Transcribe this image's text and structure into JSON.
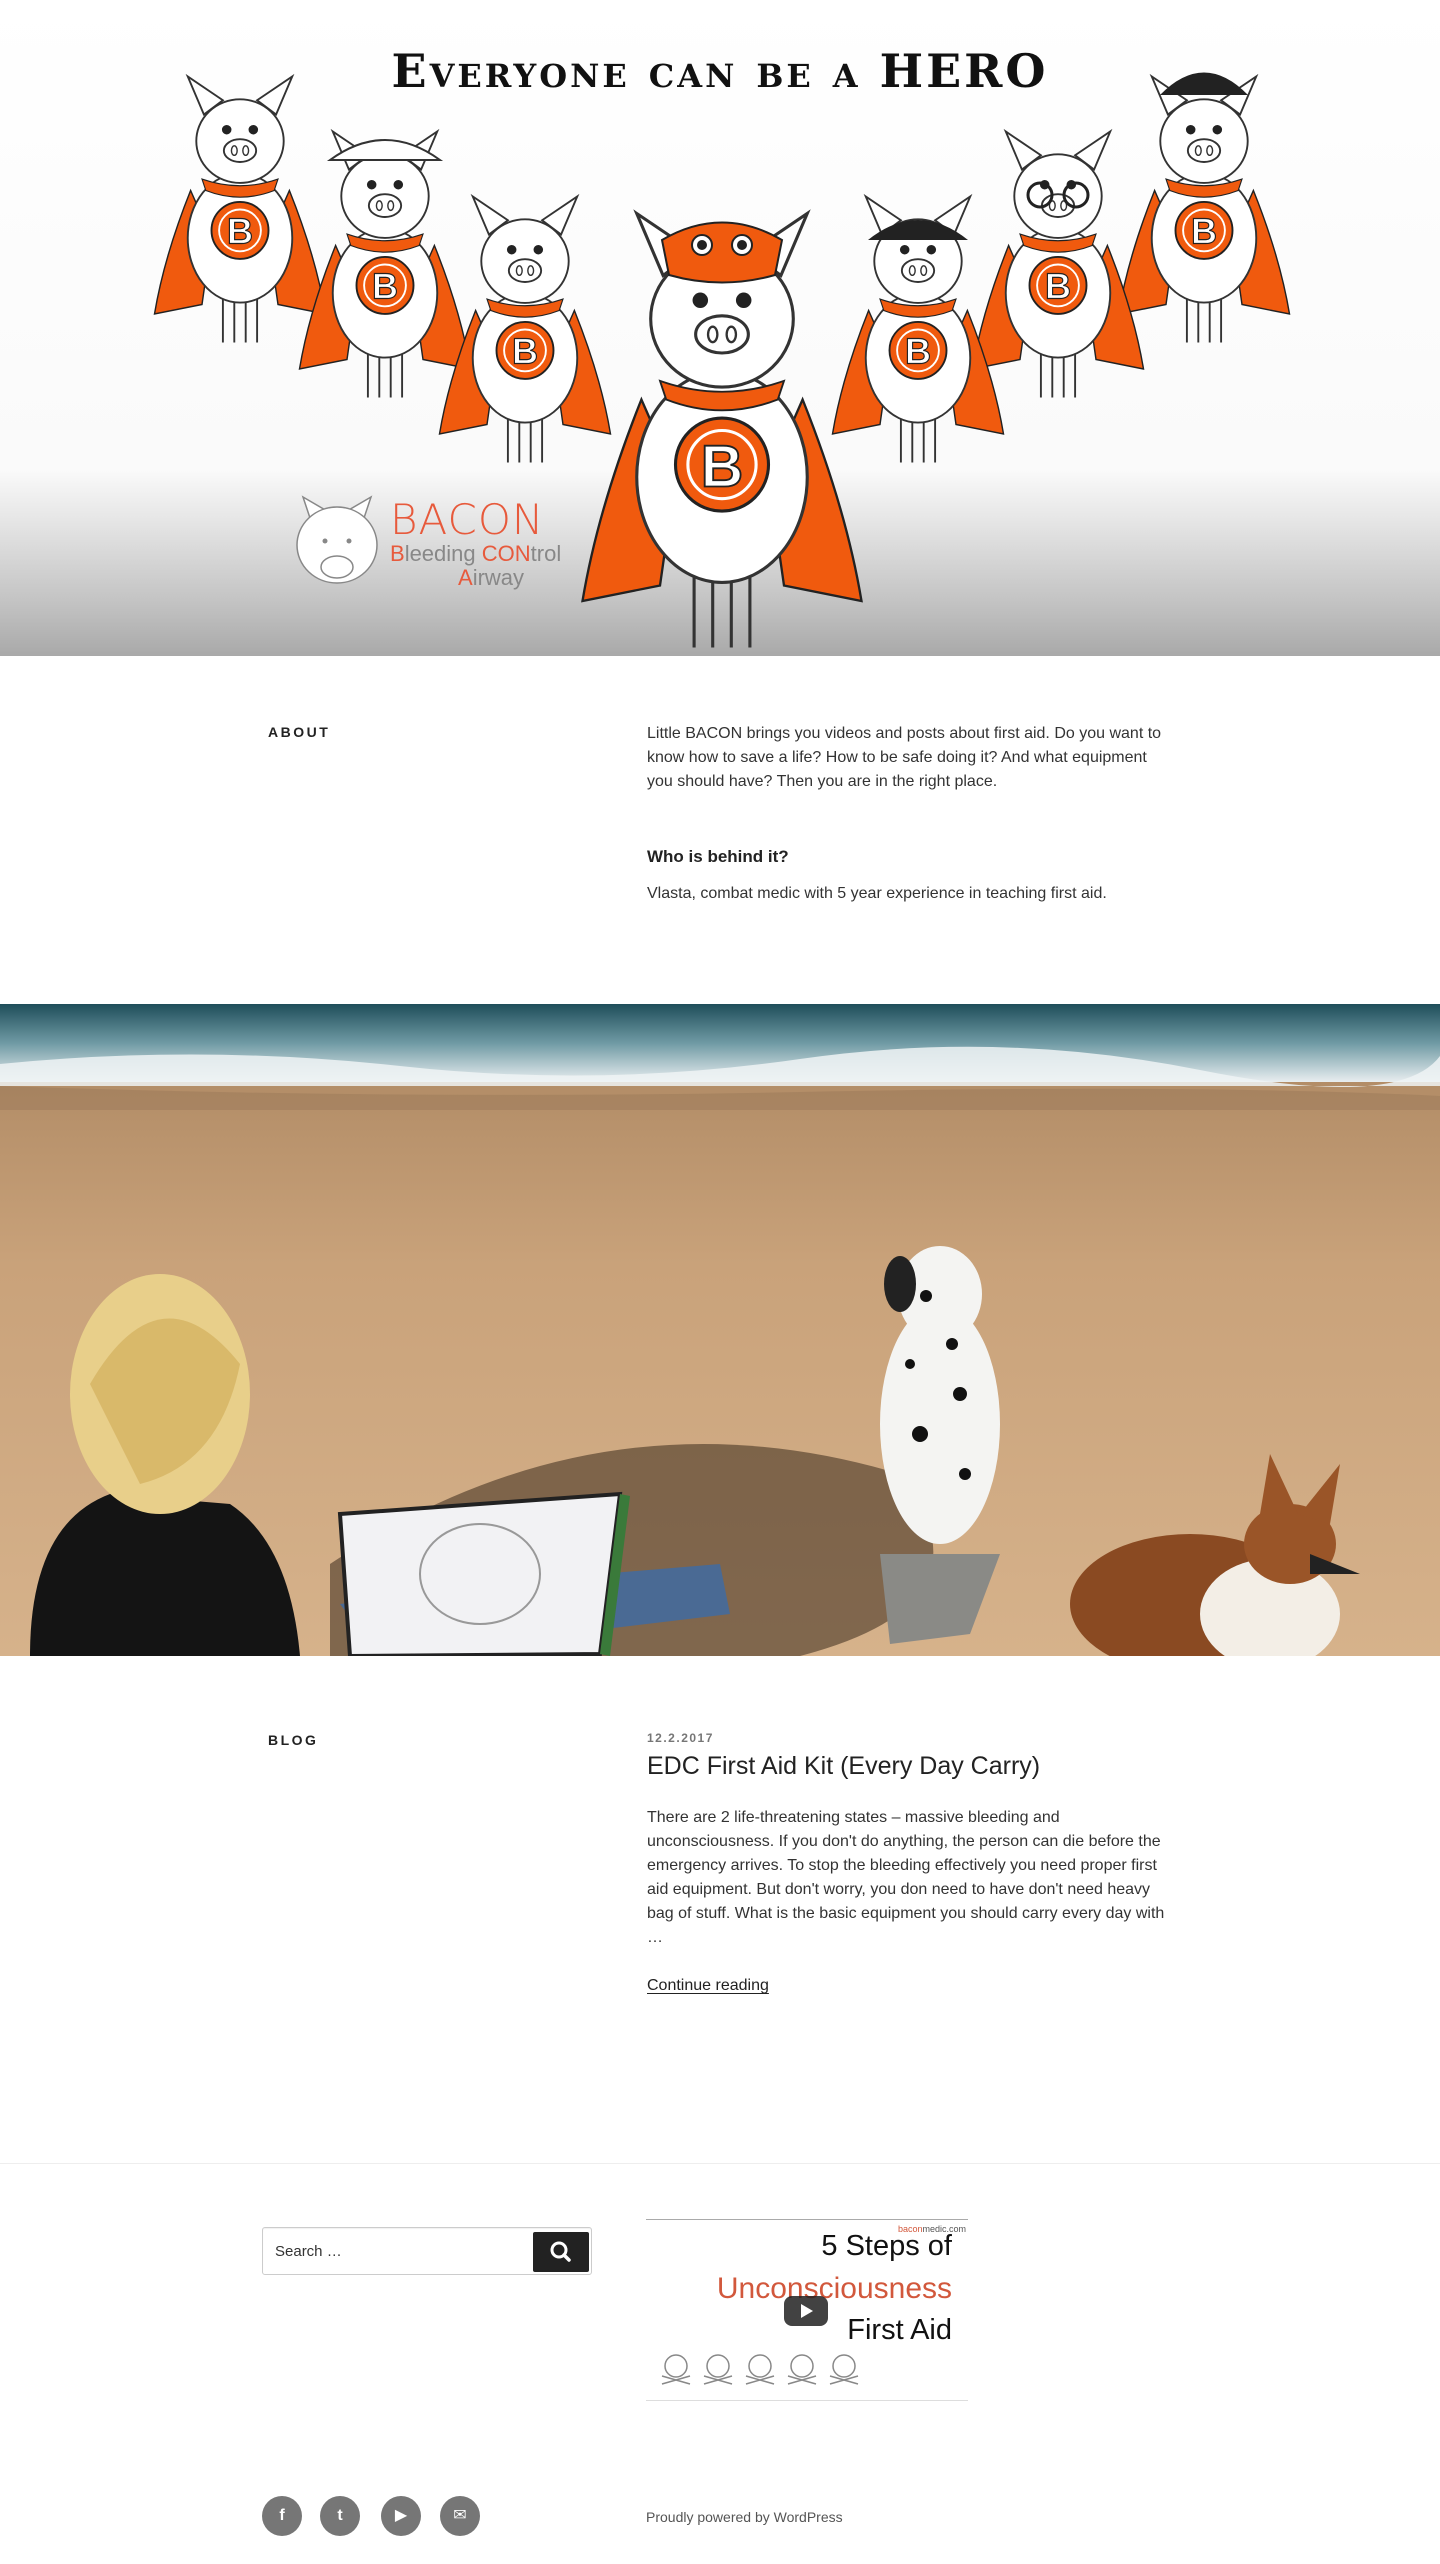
{
  "hero": {
    "title": "Everyone can be a HERO",
    "logo": {
      "word": "BACON",
      "line2_prefix": "B",
      "line2_rest": "leeding ",
      "line2_accent": "CON",
      "line2_suffix": "trol",
      "line3_prefix": "A",
      "line3_rest": "irway"
    },
    "badge_letter": "B"
  },
  "about": {
    "label": "ABOUT",
    "intro": "Little BACON brings you videos and posts about first aid. Do you want to know how to save a life? How to be safe doing it? And what equipment you should have? Then you are in the right place.",
    "subheading": "Who is behind it?",
    "bio": "Vlasta, combat medic with 5 year experience in teaching first aid."
  },
  "blog": {
    "label": "BLOG",
    "post": {
      "date": "12.2.2017",
      "title": "EDC First Aid Kit (Every Day Carry)",
      "excerpt": "There are 2 life-threatening states – massive bleeding and unconsciousness. If you don't do anything, the person can die before the emergency arrives. To stop the bleeding effectively you need proper first aid equipment. But don't worry, you don need to have don't need heavy bag of stuff. What is the basic equipment you should carry every day with …",
      "continue_label": "Continue reading"
    }
  },
  "footer": {
    "search": {
      "placeholder": "Search …"
    },
    "video": {
      "brand_a": "bacon",
      "brand_b": "medic.com",
      "line1": "5 Steps of",
      "line2": "Unconsciousness",
      "line3": "First Aid"
    },
    "social": [
      {
        "name": "facebook",
        "glyph": "f"
      },
      {
        "name": "twitter",
        "glyph": "t"
      },
      {
        "name": "youtube",
        "glyph": "▶"
      },
      {
        "name": "email",
        "glyph": "✉"
      }
    ],
    "powered": "Proudly powered by WordPress"
  },
  "colors": {
    "accent_orange": "#f05a0e",
    "text": "#333333",
    "social_grey": "#767676"
  }
}
